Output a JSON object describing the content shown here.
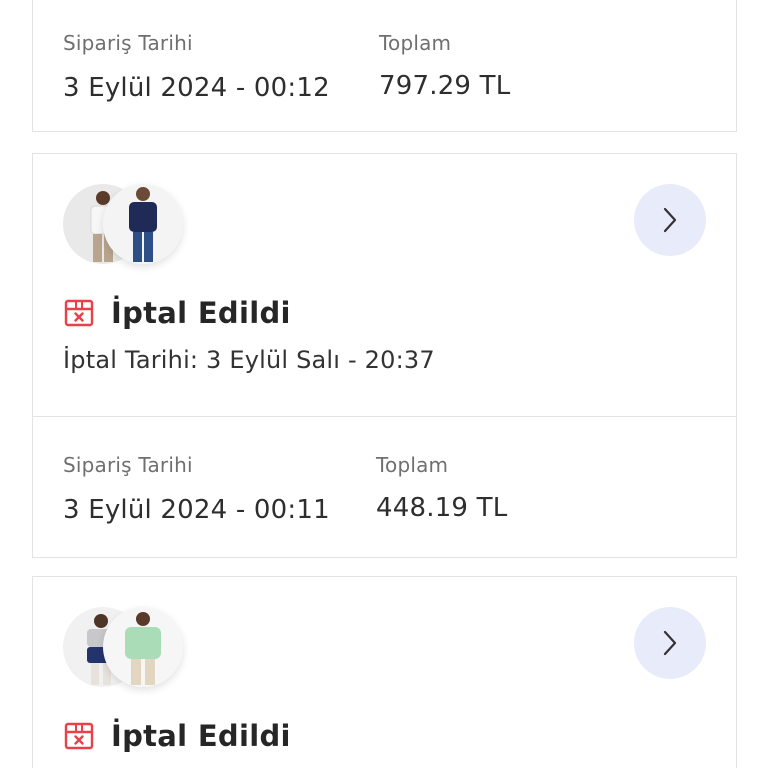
{
  "orders": [
    {
      "summary": {
        "date_label": "Sipariş Tarihi",
        "date_value": "3 Eylül 2024 - 00:12",
        "total_label": "Toplam",
        "total_value": "797.29 TL"
      }
    },
    {
      "status": "İptal Edildi",
      "cancel_date": "İptal Tarihi: 3 Eylül Salı - 20:37",
      "thumbnails": [
        "man-tshirt-photo",
        "man-sweatshirt-photo"
      ],
      "summary": {
        "date_label": "Sipariş Tarihi",
        "date_value": "3 Eylül 2024 - 00:11",
        "total_label": "Toplam",
        "total_value": "448.19 TL"
      }
    },
    {
      "status": "İptal Edildi",
      "thumbnails": [
        "kid-hoodie-photo",
        "kid-green-hoodie-photo"
      ]
    }
  ],
  "colors": {
    "accent_red": "#e8414a",
    "arrow_button_bg": "#e8ebf9",
    "border": "#e3e3e3"
  },
  "icons": {
    "chevron": "chevron-right-icon",
    "status": "cancelled-box-icon"
  }
}
